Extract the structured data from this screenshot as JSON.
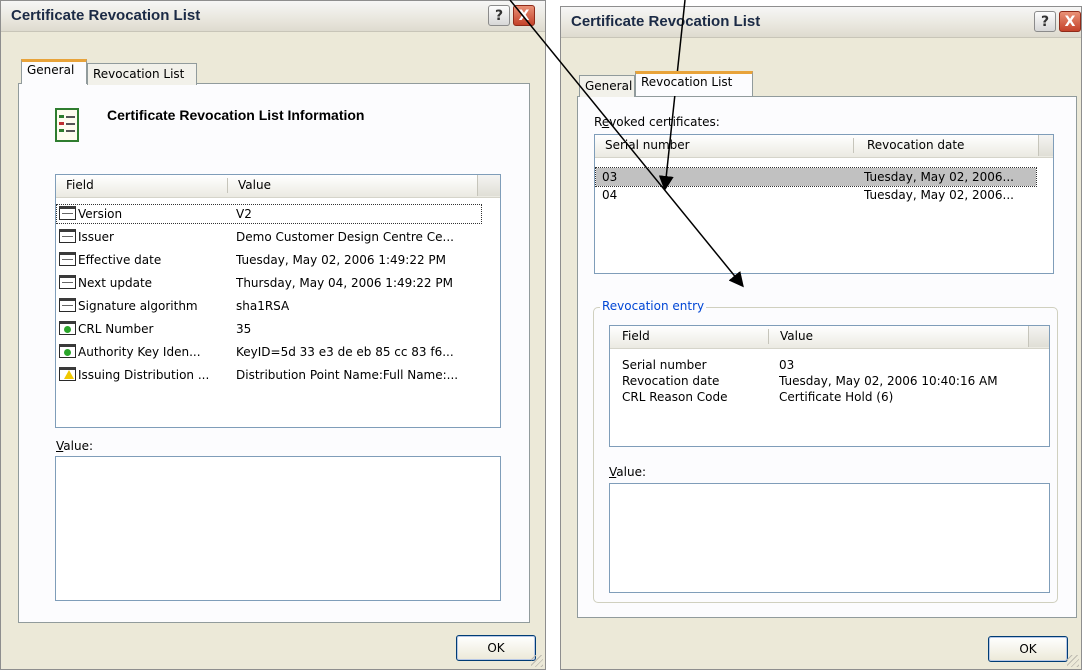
{
  "left_dialog": {
    "title": "Certificate Revocation List",
    "help_label": "?",
    "close_label": "X",
    "tabs": [
      "General",
      "Revocation List"
    ],
    "heading": "Certificate Revocation List Information",
    "fields_header": {
      "field": "Field",
      "value": "Value"
    },
    "fields": [
      {
        "icon": "document-icon",
        "field": "Version",
        "value": "V2"
      },
      {
        "icon": "document-icon",
        "field": "Issuer",
        "value": "Demo Customer Design Centre Ce..."
      },
      {
        "icon": "document-icon",
        "field": "Effective date",
        "value": "Tuesday, May 02, 2006 1:49:22 PM"
      },
      {
        "icon": "document-icon",
        "field": "Next update",
        "value": "Thursday, May 04, 2006 1:49:22 PM"
      },
      {
        "icon": "document-icon",
        "field": "Signature algorithm",
        "value": "sha1RSA"
      },
      {
        "icon": "extension-icon",
        "field": "CRL Number",
        "value": "35"
      },
      {
        "icon": "extension-icon",
        "field": "Authority Key Iden...",
        "value": "KeyID=5d 33 e3 de eb 85 cc 83 f6..."
      },
      {
        "icon": "critical-extension-icon",
        "field": "Issuing Distribution ...",
        "value": "Distribution Point Name:Full Name:..."
      }
    ],
    "value_label_u": "V",
    "value_label_rest": "alue:",
    "ok_label": "OK"
  },
  "right_dialog": {
    "title": "Certificate Revocation List",
    "help_label": "?",
    "close_label": "X",
    "tabs": [
      "General",
      "Revocation List"
    ],
    "revoked_label_pre": "R",
    "revoked_label_u": "e",
    "revoked_label_post": "voked certificates:",
    "revoked_header": {
      "serial": "Serial number",
      "date": "Revocation date"
    },
    "revoked": [
      {
        "serial": "03",
        "date": "Tuesday, May 02, 2006..."
      },
      {
        "serial": "04",
        "date": "Tuesday, May 02, 2006..."
      }
    ],
    "entry_group_title": "Revocation entry",
    "entry_header": {
      "field": "Field",
      "value": "Value"
    },
    "entry": [
      {
        "field": "Serial number",
        "value": "03"
      },
      {
        "field": "Revocation date",
        "value": "Tuesday, May 02, 2006 10:40:16 AM"
      },
      {
        "field": "CRL Reason Code",
        "value": "Certificate Hold (6)"
      }
    ],
    "value_label_u": "V",
    "value_label_rest": "alue:",
    "ok_label": "OK"
  },
  "colors": {
    "dialog_bg": "#ece9d8",
    "active_tab_accent": "#e8a33a",
    "group_title": "#0046d5",
    "close_button": "#c4422a",
    "selected_row": "#c1c1c1"
  }
}
